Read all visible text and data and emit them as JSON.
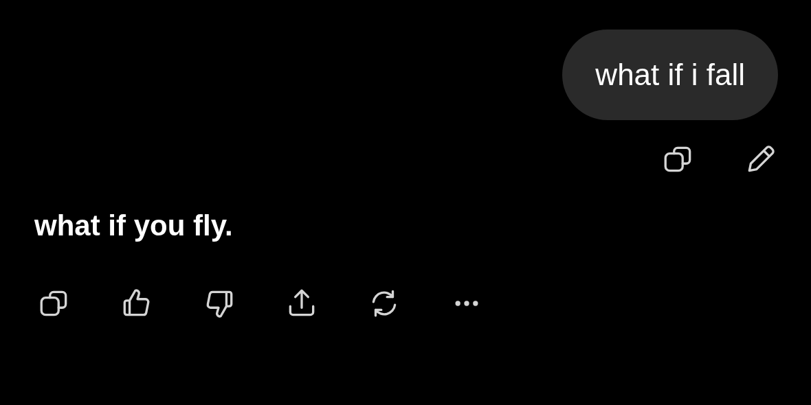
{
  "user_message": {
    "text": "what if i fall"
  },
  "user_actions": [
    {
      "kind": "copy"
    },
    {
      "kind": "edit"
    }
  ],
  "assistant_message": {
    "text": "what if you fly."
  },
  "assistant_actions": [
    {
      "kind": "copy"
    },
    {
      "kind": "like"
    },
    {
      "kind": "dislike"
    },
    {
      "kind": "share"
    },
    {
      "kind": "regenerate"
    },
    {
      "kind": "more"
    }
  ]
}
